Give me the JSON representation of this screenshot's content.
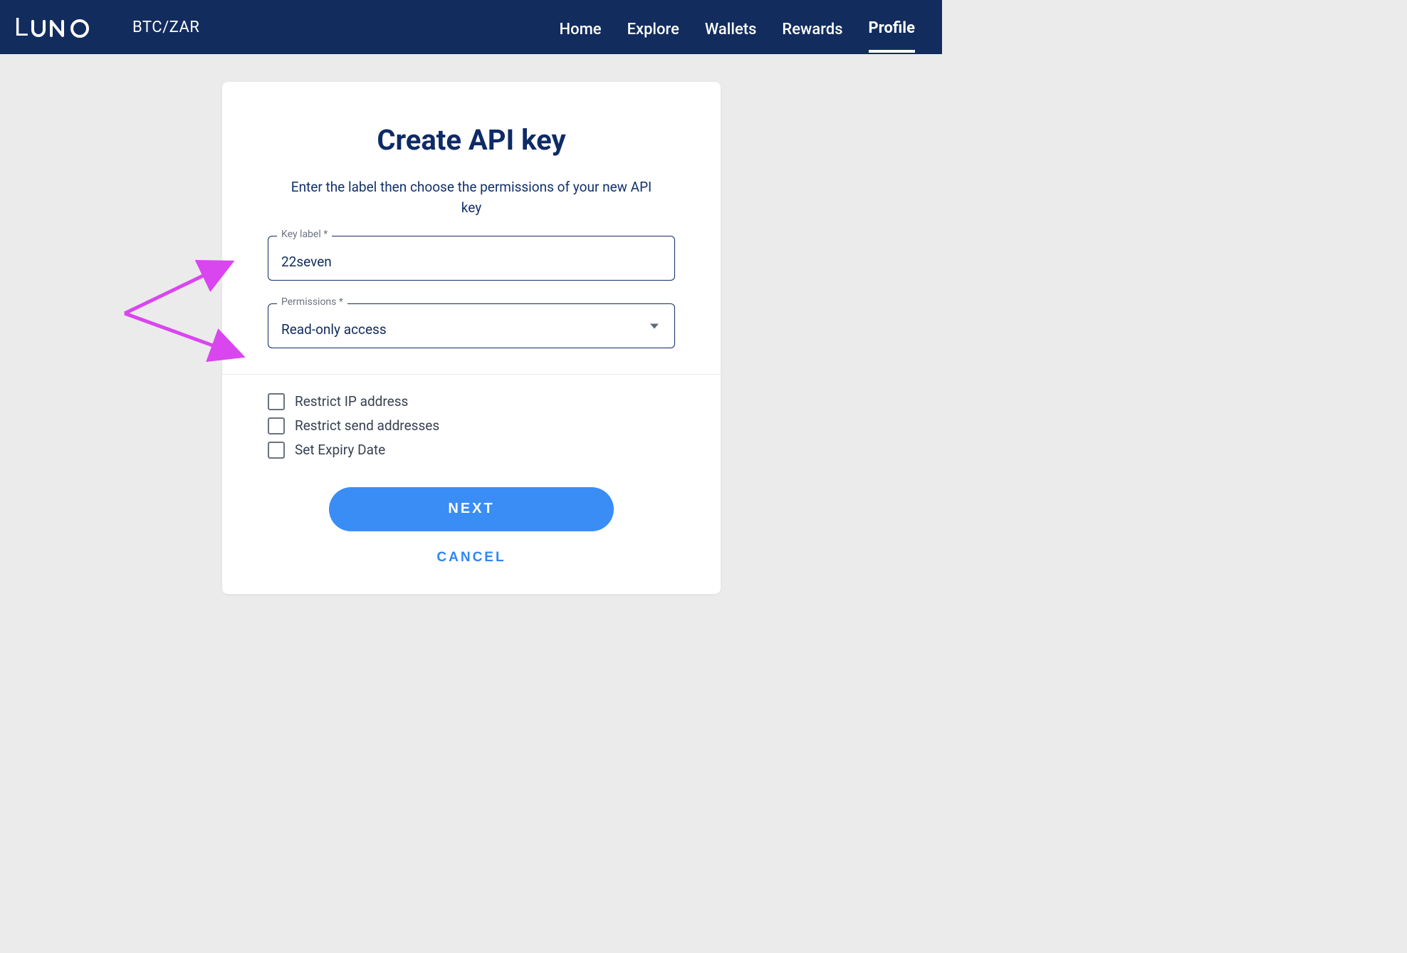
{
  "nav": {
    "pair": "BTC/ZAR",
    "items": [
      "Home",
      "Explore",
      "Wallets",
      "Rewards",
      "Profile"
    ],
    "active": "Profile"
  },
  "card": {
    "title": "Create API key",
    "subtitle": "Enter the label then choose the permissions of your new API key",
    "key_label": {
      "legend": "Key label *",
      "value": "22seven"
    },
    "permissions": {
      "legend": "Permissions *",
      "value": "Read-only access"
    },
    "checks": [
      "Restrict IP address",
      "Restrict send addresses",
      "Set Expiry Date"
    ],
    "next_label": "NEXT",
    "cancel_label": "CANCEL"
  }
}
